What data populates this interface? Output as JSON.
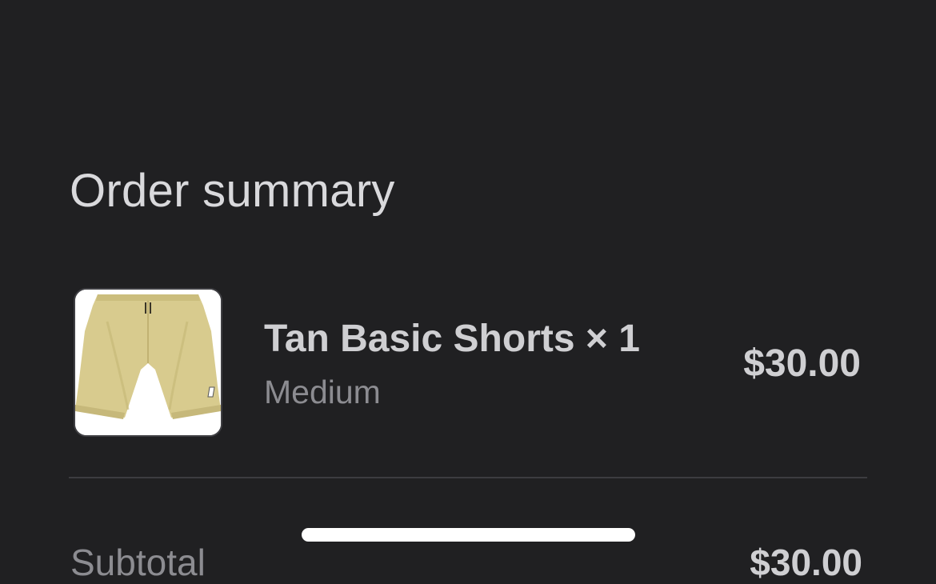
{
  "order_summary": {
    "title": "Order summary",
    "items": [
      {
        "name": "Tan Basic Shorts × 1",
        "variant": "Medium",
        "price": "$30.00",
        "image_icon": "tan-shorts-product-image"
      }
    ],
    "subtotal": {
      "label": "Subtotal",
      "value": "$30.00"
    }
  },
  "colors": {
    "background": "#202022",
    "primary_text": "#cfcfd2",
    "secondary_text": "#8c8c91",
    "product_tan": "#d8cb8e"
  }
}
